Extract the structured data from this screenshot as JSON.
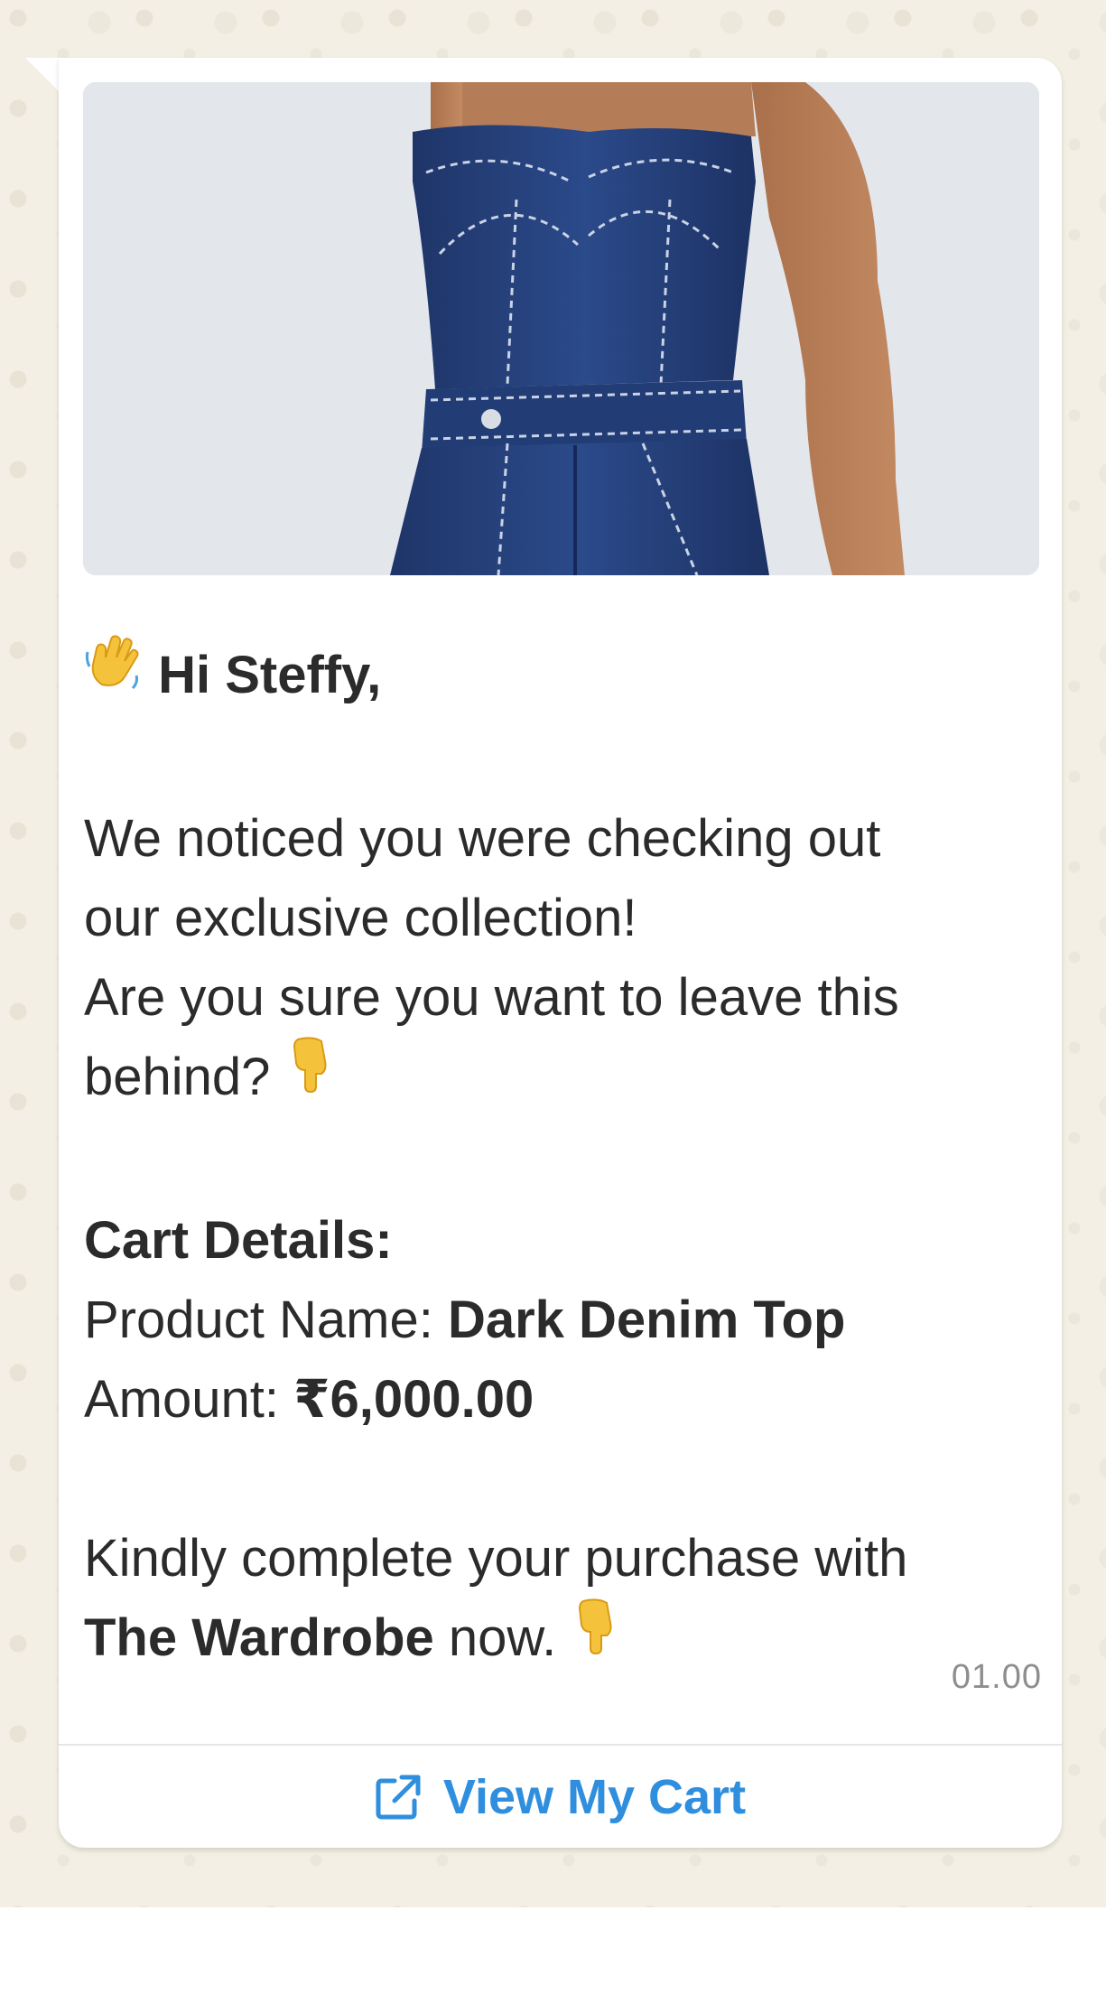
{
  "message": {
    "greeting": "Hi Steffy,",
    "line1": "We noticed you were checking out",
    "line2": "our exclusive collection!",
    "line3": "Are you sure you want to leave this",
    "line4": "behind?",
    "cart_heading": "Cart Details:",
    "product_label": "Product Name:",
    "product_name": "Dark Denim Top",
    "amount_label": "Amount:",
    "amount_value": "₹6,000.00",
    "closing_line1": "Kindly complete your purchase with",
    "brand": "The Wardrobe",
    "closing_line2_suffix": "now.",
    "timestamp": "01.00"
  },
  "cta": {
    "label": "View My Cart",
    "icon": "external-link-icon"
  },
  "icons": {
    "greeting": "waving-hand-icon",
    "pointer": "pointing-down-icon"
  },
  "colors": {
    "chat_background": "#f3efe4",
    "bubble": "#ffffff",
    "text": "#2b2b2b",
    "link": "#2f8fde",
    "timestamp": "#8e8e8e",
    "denim": "#243f7a"
  }
}
